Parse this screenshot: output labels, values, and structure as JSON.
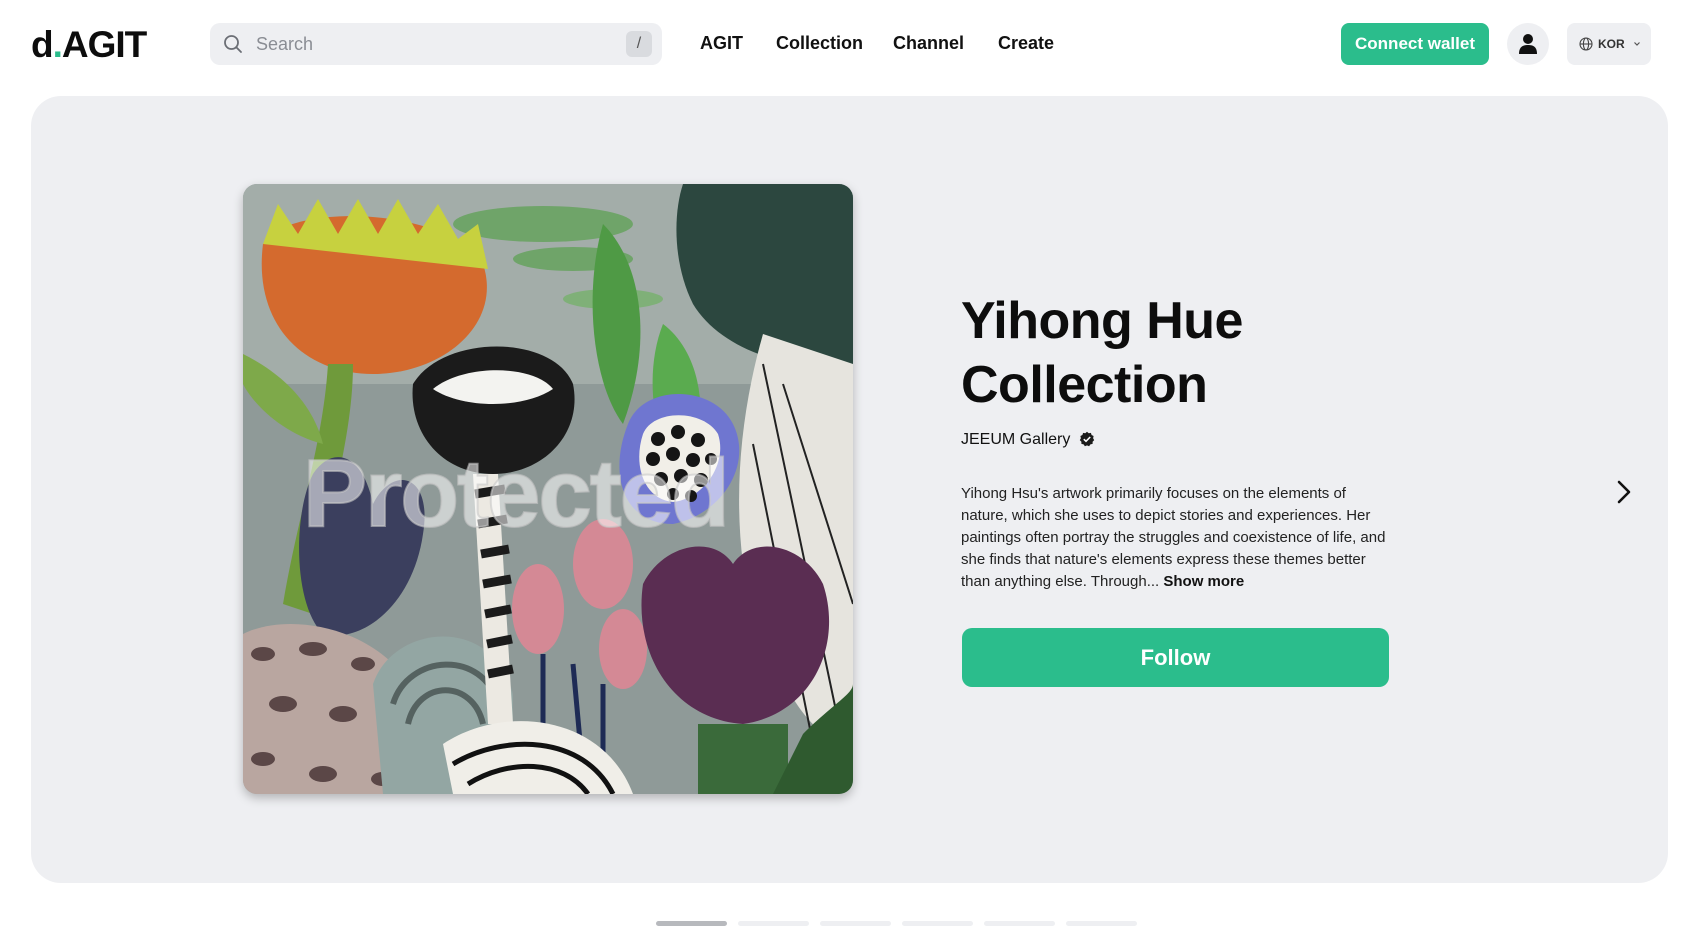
{
  "header": {
    "logo_prefix": "d",
    "logo_dot": ".",
    "logo_suffix": "AGIT",
    "search_placeholder": "Search",
    "search_shortcut": "/",
    "nav": [
      "AGIT",
      "Collection",
      "Channel",
      "Create"
    ],
    "connect_wallet": "Connect wallet",
    "language": "KOR"
  },
  "hero": {
    "title_line1": "Yihong Hue",
    "title_line2": "Collection",
    "creator": "JEEUM Gallery",
    "watermark": "Protected",
    "description": "Yihong Hsu's artwork primarily focuses on the elements of nature, which she uses to depict stories and experiences. Her paintings often portray the struggles and coexistence of life, and she finds that nature's elements express these themes better than anything else. Through...",
    "show_more": "Show more",
    "follow": "Follow"
  },
  "pager": {
    "count": 6,
    "active_index": 0
  },
  "colors": {
    "accent": "#2bbd8c",
    "hero_bg": "#eeeff2",
    "pager_active": "#b7b9bd",
    "pager_inactive": "#eeeff2"
  },
  "icons": [
    "search-icon",
    "user-icon",
    "globe-icon",
    "chevron-down-icon",
    "verified-icon",
    "chevron-right-icon"
  ]
}
